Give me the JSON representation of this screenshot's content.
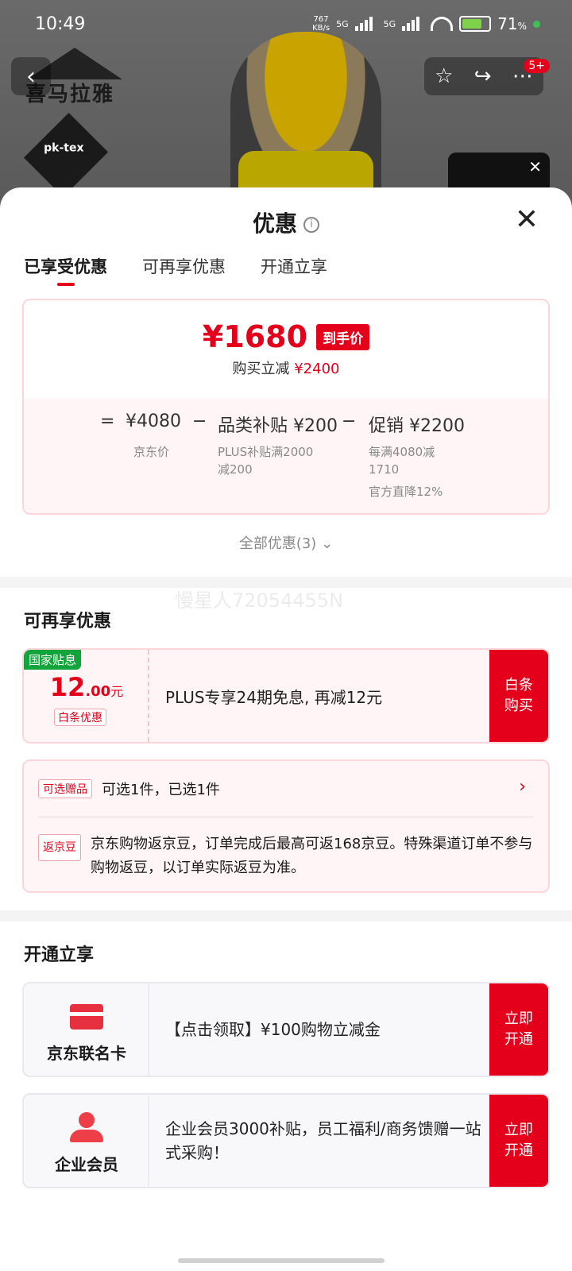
{
  "status_bar": {
    "time": "10:49",
    "speed_top": "767",
    "speed_unit": "KB/s",
    "net1": "5G",
    "net2": "5G",
    "battery": "71",
    "battery_unit": "%",
    "notif_count": "5+"
  },
  "background": {
    "brand_logo_text": "喜马拉雅",
    "badge_text": "pk-tex"
  },
  "sheet": {
    "title": "优惠",
    "tabs": [
      "已享受优惠",
      "可再享优惠",
      "开通立享"
    ],
    "price": {
      "final": "¥1680",
      "final_tag": "到手价",
      "reduce_label": "购买立减",
      "reduce_value": "¥2400",
      "eq": "=",
      "base": "¥4080",
      "base_note": "京东价",
      "minus1": "−",
      "sub1_label": "品类补贴",
      "sub1_value": "¥200",
      "sub1_note_1": "PLUS补贴满2000",
      "sub1_note_2": "减200",
      "minus2": "−",
      "sub2_label": "促销",
      "sub2_value": "¥2200",
      "sub2_note_1": "每满4080减",
      "sub2_note_2": "1710",
      "sub2_note_3": "官方直降12%"
    },
    "all_offers": "全部优惠(3)",
    "watermark": "慢星人72054455N",
    "section_more": "可再享优惠",
    "coupon": {
      "badge": "国家贴息",
      "amount_int": "12",
      "amount_dec": ".00",
      "amount_unit": "元",
      "tag": "白条优惠",
      "desc": "PLUS专享24期免息, 再减12元",
      "action_1": "白条",
      "action_2": "购买"
    },
    "gift": {
      "tag": "可选赠品",
      "text": "可选1件，已选1件",
      "jd_tag": "返京豆",
      "jd_text": "京东购物返京豆，订单完成后最高可返168京豆。特殊渠道订单不参与购物返豆，以订单实际返豆为准。"
    },
    "section_open": "开通立享",
    "open_items": [
      {
        "icon": "credit-card-icon",
        "label": "京东联名卡",
        "desc": "【点击领取】¥100购物立减金",
        "action_1": "立即",
        "action_2": "开通"
      },
      {
        "icon": "user-icon",
        "label": "企业会员",
        "desc": " 企业会员3000补贴，员工福利/商务馈赠一站式采购！",
        "action_1": "立即",
        "action_2": "开通"
      }
    ]
  }
}
